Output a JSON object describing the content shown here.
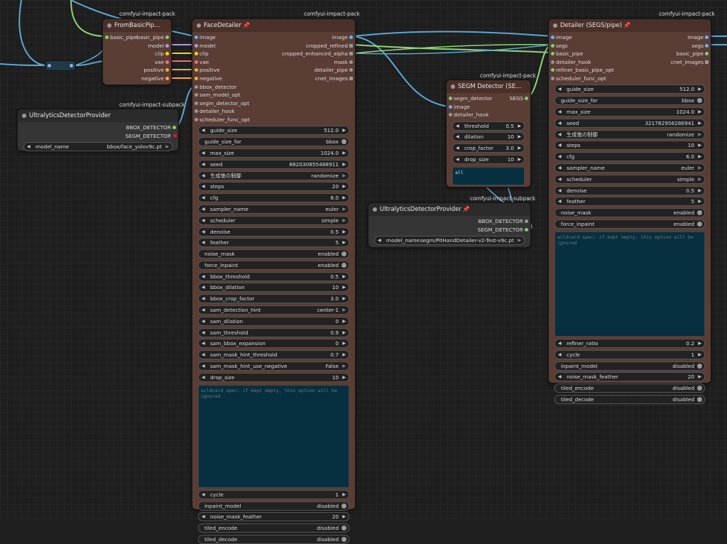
{
  "colors": {
    "image": "#64b5f6",
    "model": "#b39ddb",
    "clip": "#ffd500",
    "vae": "#ff6e6e",
    "conditioning": "#ffa931",
    "generic": "#999999",
    "pipe": "#7ed36b",
    "wire_blue": "#5aa9d6",
    "wire_green": "#8ed878"
  },
  "nodes": {
    "from_basic_pipe": {
      "pack": "comfyui-impact-pack",
      "title": "FromBasicPip...",
      "input": "basic_pipe",
      "outputs": [
        "basic_pipe",
        "model",
        "clip",
        "vae",
        "positive",
        "negative"
      ]
    },
    "ultralytics_1": {
      "pack": "comfyui-impact-subpack",
      "title": "UltralyticsDetectorProvider",
      "outputs": [
        "BBOX_DETECTOR",
        "SEGM_DETECTOR"
      ],
      "model_name_label": "model_name",
      "model_name_value": "bbox/face_yolov9c.pt"
    },
    "face_detailer": {
      "pack": "comfyui-impact-pack",
      "title": "FaceDetailer",
      "pin_icon": "pin-icon",
      "inputs": [
        "image",
        "model",
        "clip",
        "vae",
        "positive",
        "negative",
        "bbox_detector",
        "sam_model_opt",
        "segm_detector_opt",
        "detailer_hook",
        "scheduler_func_opt"
      ],
      "outputs": [
        "image",
        "cropped_refined",
        "cropped_enhanced_alpha",
        "mask",
        "detailer_pipe",
        "cnet_images"
      ],
      "widgets_a": [
        {
          "label": "guide_size",
          "value": "512.0"
        },
        {
          "label": "guide_size_for",
          "value": "bbox",
          "toggle": true
        },
        {
          "label": "max_size",
          "value": "1024.0"
        },
        {
          "label": "seed",
          "value": "882030855488911"
        },
        {
          "label": "生成後の制御",
          "value": "randomize",
          "combo": true
        },
        {
          "label": "steps",
          "value": "20"
        },
        {
          "label": "cfg",
          "value": "8.0"
        },
        {
          "label": "sampler_name",
          "value": "euler",
          "combo": true
        },
        {
          "label": "scheduler",
          "value": "simple",
          "combo": true
        },
        {
          "label": "denoise",
          "value": "0.5"
        },
        {
          "label": "feather",
          "value": "5"
        },
        {
          "label": "noise_mask",
          "value": "enabled",
          "toggle": true
        },
        {
          "label": "force_inpaint",
          "value": "enabled",
          "toggle": true
        },
        {
          "label": "bbox_threshold",
          "value": "0.5"
        },
        {
          "label": "bbox_dilation",
          "value": "10"
        },
        {
          "label": "bbox_crop_factor",
          "value": "3.0"
        },
        {
          "label": "sam_detection_hint",
          "value": "center-1",
          "combo": true
        },
        {
          "label": "sam_dilation",
          "value": "0"
        },
        {
          "label": "sam_threshold",
          "value": "0.9"
        },
        {
          "label": "sam_bbox_expansion",
          "value": "0"
        },
        {
          "label": "sam_mask_hint_threshold",
          "value": "0.7"
        },
        {
          "label": "sam_mask_hint_use_negative",
          "value": "False",
          "combo": true
        },
        {
          "label": "drop_size",
          "value": "10"
        }
      ],
      "wildcard_placeholder": "wildcard spec: if kept empty, this option will be ignored",
      "widgets_b": [
        {
          "label": "cycle",
          "value": "1"
        },
        {
          "label": "inpaint_model",
          "value": "disabled",
          "toggle": true
        },
        {
          "label": "noise_mask_feather",
          "value": "20"
        },
        {
          "label": "tiled_encode",
          "value": "disabled",
          "toggle": true
        },
        {
          "label": "tiled_decode",
          "value": "disabled",
          "toggle": true
        }
      ]
    },
    "segm_detector": {
      "pack": "comfyui-impact-pack",
      "title": "SEGM Detector (SE...",
      "inputs": [
        "segm_detector",
        "image",
        "detailer_hook"
      ],
      "output": "SEGS",
      "widgets": [
        {
          "label": "threshold",
          "value": "0.5"
        },
        {
          "label": "dilation",
          "value": "10"
        },
        {
          "label": "crop_factor",
          "value": "3.0"
        },
        {
          "label": "drop_size",
          "value": "10"
        }
      ],
      "text_value": "all"
    },
    "ultralytics_2": {
      "pack": "comfyui-impact-subpack",
      "title": "UltralyticsDetectorProvider",
      "pin_icon": "pin-icon",
      "outputs": [
        "BBOX_DETECTOR",
        "SEGM_DETECTOR"
      ],
      "model_name_label": "model_name",
      "model_name_value": "segm/PitHandDetailer-v2-Test-v9c.pt"
    },
    "detailer_segs": {
      "pack": "comfyui-impact-pack",
      "title": "Detailer (SEGS/pipe)",
      "pin_icon": "pin-icon",
      "inputs": [
        "image",
        "segs",
        "basic_pipe",
        "detailer_hook",
        "refiner_basic_pipe_opt",
        "scheduler_func_opt"
      ],
      "outputs": [
        "image",
        "segs",
        "basic_pipe",
        "cnet_images"
      ],
      "widgets_a": [
        {
          "label": "guide_size",
          "value": "512.0"
        },
        {
          "label": "guide_size_for",
          "value": "bbox",
          "toggle": true
        },
        {
          "label": "max_size",
          "value": "1024.0"
        },
        {
          "label": "seed",
          "value": "321782956286941"
        },
        {
          "label": "生成後の制御",
          "value": "randomize",
          "combo": true
        },
        {
          "label": "steps",
          "value": "10"
        },
        {
          "label": "cfg",
          "value": "6.0"
        },
        {
          "label": "sampler_name",
          "value": "euler",
          "combo": true
        },
        {
          "label": "scheduler",
          "value": "simple",
          "combo": true
        },
        {
          "label": "denoise",
          "value": "0.5"
        },
        {
          "label": "feather",
          "value": "5"
        },
        {
          "label": "noise_mask",
          "value": "enabled",
          "toggle": true
        },
        {
          "label": "force_inpaint",
          "value": "enabled",
          "toggle": true
        }
      ],
      "wildcard_placeholder": "wildcard spec: if kept empty, this option will be ignored",
      "widgets_b": [
        {
          "label": "refiner_ratio",
          "value": "0.2"
        },
        {
          "label": "cycle",
          "value": "1"
        },
        {
          "label": "inpaint_model",
          "value": "disabled",
          "toggle": true
        },
        {
          "label": "noise_mask_feather",
          "value": "20"
        },
        {
          "label": "tiled_encode",
          "value": "disabled",
          "toggle": true
        },
        {
          "label": "tiled_decode",
          "value": "disabled",
          "toggle": true
        }
      ]
    }
  }
}
